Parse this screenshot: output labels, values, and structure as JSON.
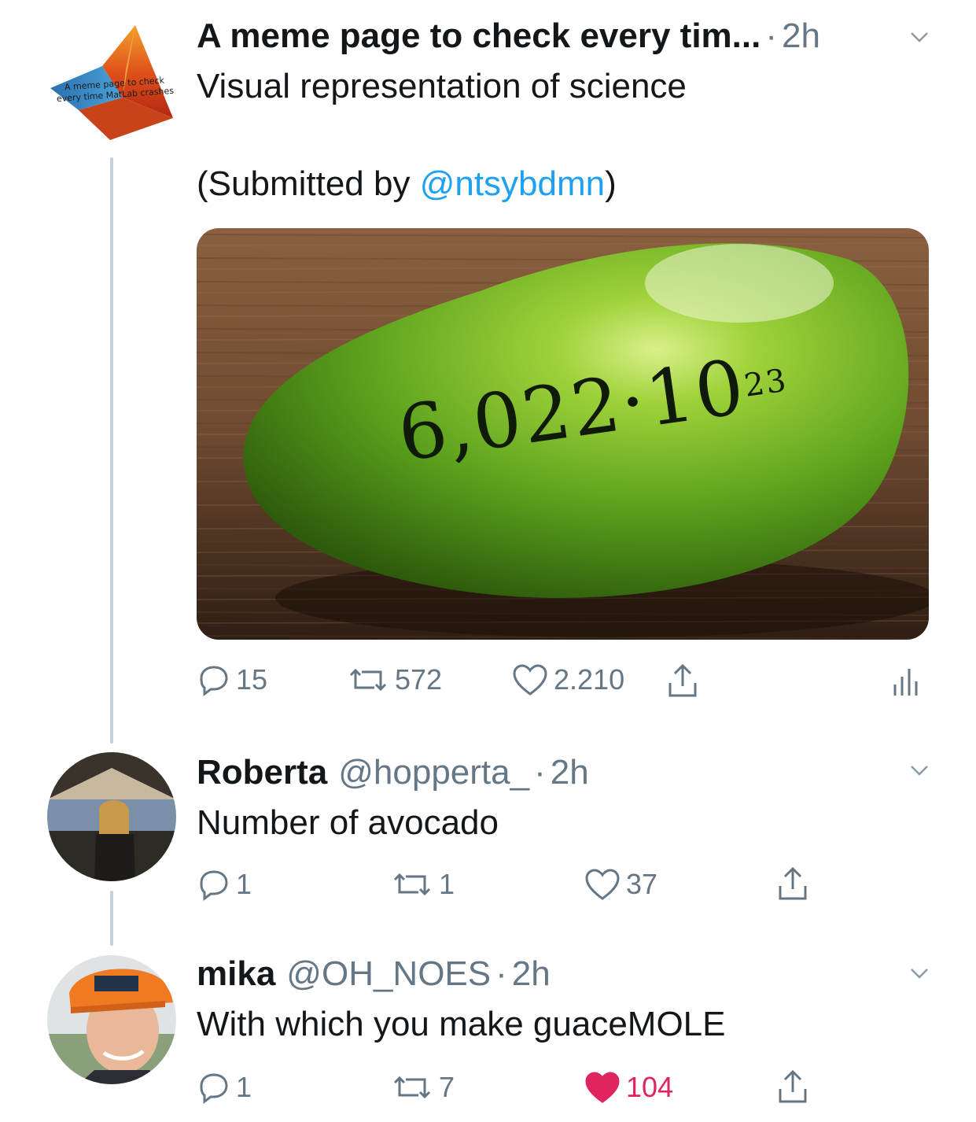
{
  "tweet": {
    "author_name": "A meme page to check every tim...",
    "time": "2h",
    "avatar_logo_text": "A meme page to check every time MatLab crashes",
    "text_line1": "Visual representation of science",
    "text_line2_prefix": "(Submitted by ",
    "mention": "@ntsybdmn",
    "text_line2_suffix": ")",
    "media": {
      "avogadro_text": "6,022·10",
      "exponent": "23"
    },
    "replies": "15",
    "retweets": "572",
    "likes": "2.210"
  },
  "replies": [
    {
      "name": "Roberta",
      "handle": "@hopperta_",
      "time": "2h",
      "text": "Number of avocado",
      "replies": "1",
      "retweets": "1",
      "likes": "37",
      "liked": false
    },
    {
      "name": "mika",
      "handle": "@OH_NOES",
      "time": "2h",
      "text": "With which you make guaceMOLE",
      "replies": "1",
      "retweets": "7",
      "likes": "104",
      "liked": true
    }
  ],
  "colors": {
    "text": "#14171a",
    "secondary": "#657786",
    "link": "#1da1f2",
    "like_active": "#e0245e",
    "thread_line": "#c6d0dc"
  }
}
